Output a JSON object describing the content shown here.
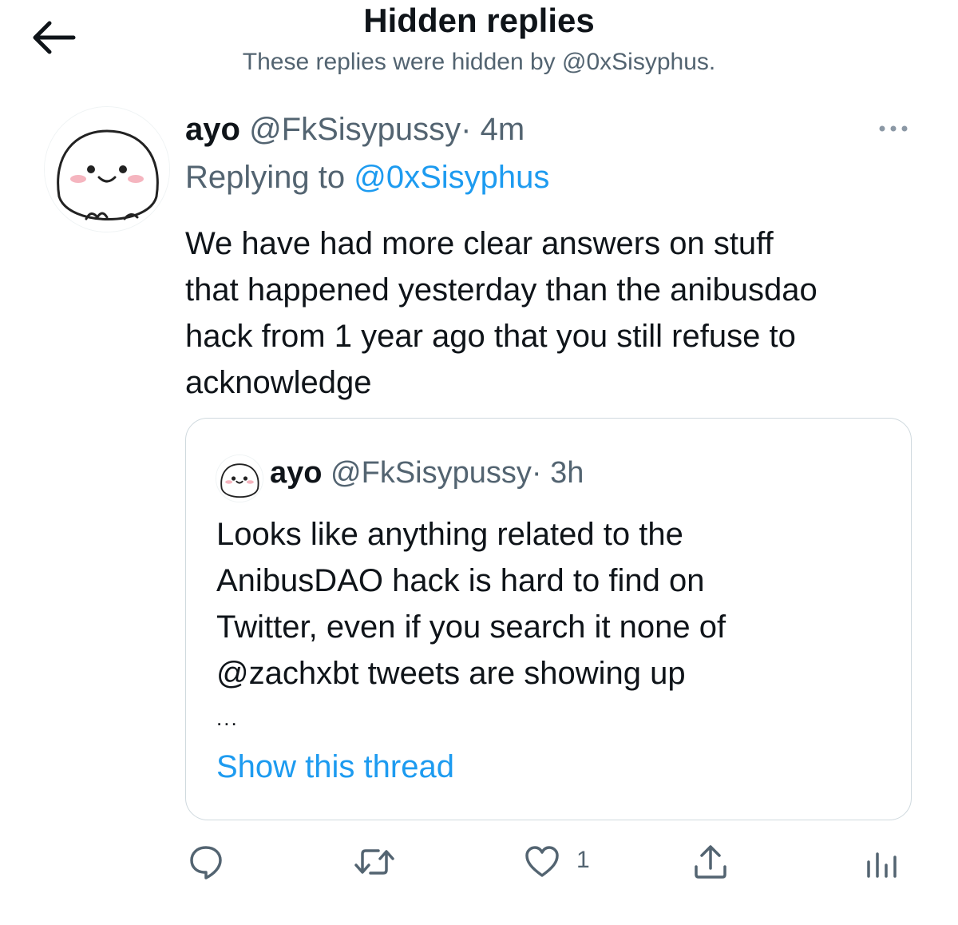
{
  "header": {
    "title": "Hidden replies",
    "subtitle": "These replies were hidden by @0xSisyphus."
  },
  "tweet": {
    "name": "ayo",
    "handle": "@FkSisypussy",
    "separator": "·",
    "time": "4m",
    "replying_prefix": "Replying to",
    "replying_to": "@0xSisyphus",
    "body_lines": [
      "We have had more clear answers on stuff",
      "that happened yesterday than the anibusdao",
      "hack from 1 year ago that you still refuse to",
      "acknowledge"
    ],
    "quoted": {
      "name": "ayo",
      "handle": "@FkSisypussy",
      "separator": "·",
      "time": "3h",
      "body_lines": [
        "Looks like anything related to the",
        "AnibusDAO hack is hard to find on",
        "Twitter, even if you search it none of",
        "@zachxbt tweets are showing up"
      ],
      "ellipsis": "...",
      "show_thread": "Show this thread"
    },
    "actions": {
      "like_count": "1"
    }
  },
  "icons": [
    "back-arrow-icon",
    "more-icon",
    "reply-icon",
    "retweet-icon",
    "like-icon",
    "share-icon",
    "analytics-icon"
  ],
  "colors": {
    "text": "#0f1419",
    "muted": "#536471",
    "accent": "#1d9bf0",
    "border": "#cfd9de"
  }
}
